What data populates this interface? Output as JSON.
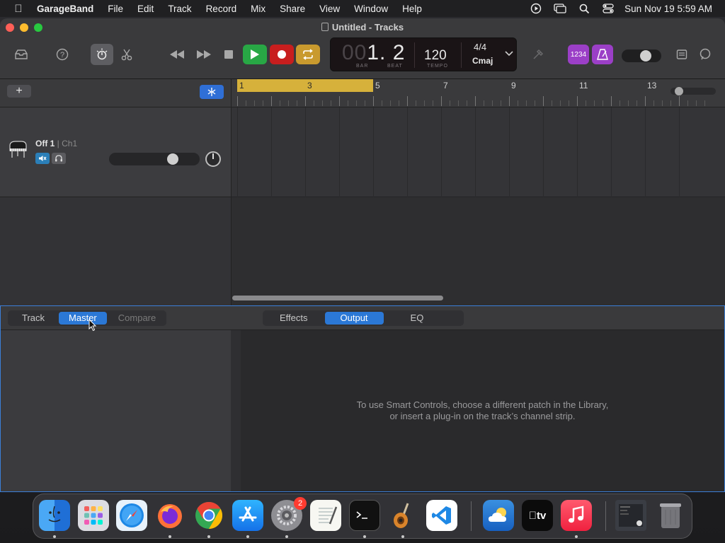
{
  "menubar": {
    "app_name": "GarageBand",
    "items": [
      "File",
      "Edit",
      "Track",
      "Record",
      "Mix",
      "Share",
      "View",
      "Window",
      "Help"
    ],
    "clock": "Sun Nov 19  5:59 AM"
  },
  "window": {
    "title": "Untitled - Tracks"
  },
  "lcd": {
    "bar_dim": "00",
    "bar_value": "1. 2",
    "bar_caption": "BAR",
    "beat_caption": "BEAT",
    "tempo": "120",
    "tempo_caption": "TEMPO",
    "time_signature": "4/4",
    "key": "Cmaj"
  },
  "count_in_label": "1234",
  "tracks": [
    {
      "name": "Off 1",
      "channel": " | Ch1"
    }
  ],
  "ruler": {
    "numbers": [
      "1",
      "3",
      "5",
      "7",
      "9",
      "11",
      "13"
    ]
  },
  "smart_controls": {
    "left_tabs": [
      "Track",
      "Master",
      "Compare"
    ],
    "left_active": "Master",
    "right_tabs": [
      "Effects",
      "Output",
      "EQ"
    ],
    "right_active": "Output",
    "message_line1": "To use Smart Controls, choose a different patch in the Library,",
    "message_line2": "or insert a plug-in on the track’s channel strip."
  },
  "dock": {
    "system_preferences_badge": "2",
    "tv_label": "tv"
  },
  "colors": {
    "play": "#28a745",
    "record": "#c81e1e",
    "cycle": "#c99a2e",
    "purple": "#9b3fc7",
    "accent": "#2b78d6",
    "cycle_region": "#d6b13b"
  }
}
